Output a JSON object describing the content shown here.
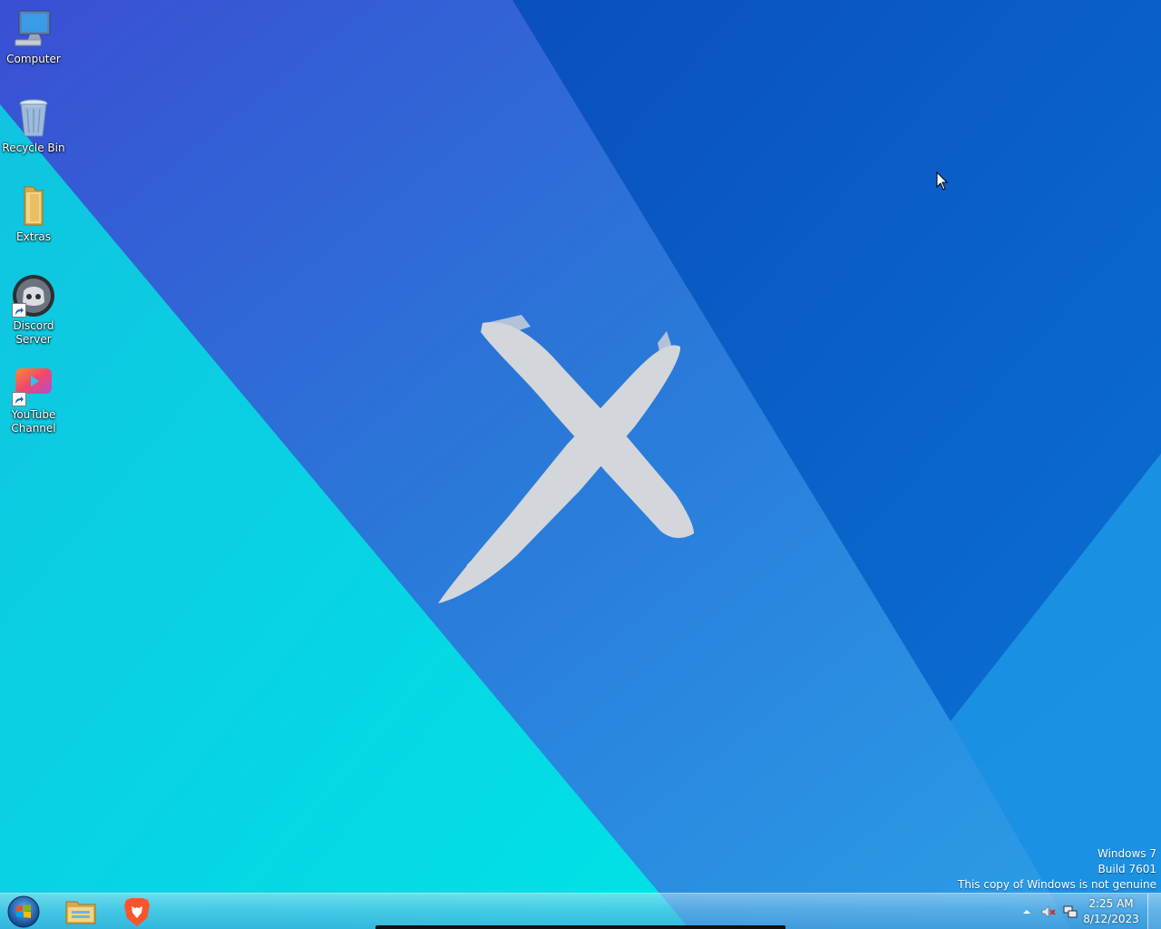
{
  "desktop": {
    "icons": [
      {
        "label": "Computer",
        "icon": "computer-icon",
        "shortcut": false
      },
      {
        "label": "Recycle Bin",
        "icon": "recycle-bin-icon",
        "shortcut": false
      },
      {
        "label": "Extras",
        "icon": "folder-icon",
        "shortcut": false
      },
      {
        "label": "Discord Server",
        "icon": "discord-icon",
        "shortcut": true
      },
      {
        "label": "YouTube Channel",
        "icon": "youtube-icon",
        "shortcut": true
      }
    ],
    "wallpaper": {
      "colors": {
        "cyan": "#00d6e3",
        "mid_blue": "#2a7ad8",
        "dark_blue": "#0a5cc4",
        "x_mark": "#d3d6da"
      }
    }
  },
  "watermark": {
    "line1": "Windows 7",
    "line2": "Build 7601",
    "line3": "This copy of Windows is not genuine"
  },
  "taskbar": {
    "start_icon": "windows-logo-icon",
    "pinned": [
      {
        "name": "file-explorer",
        "icon": "folder-icon"
      },
      {
        "name": "brave-browser",
        "icon": "brave-lion-icon"
      }
    ],
    "tray": {
      "icons": [
        "show-hidden-icons-icon",
        "volume-muted-icon",
        "network-icon"
      ]
    },
    "clock": {
      "time": "2:25 AM",
      "date": "8/12/2023"
    }
  }
}
